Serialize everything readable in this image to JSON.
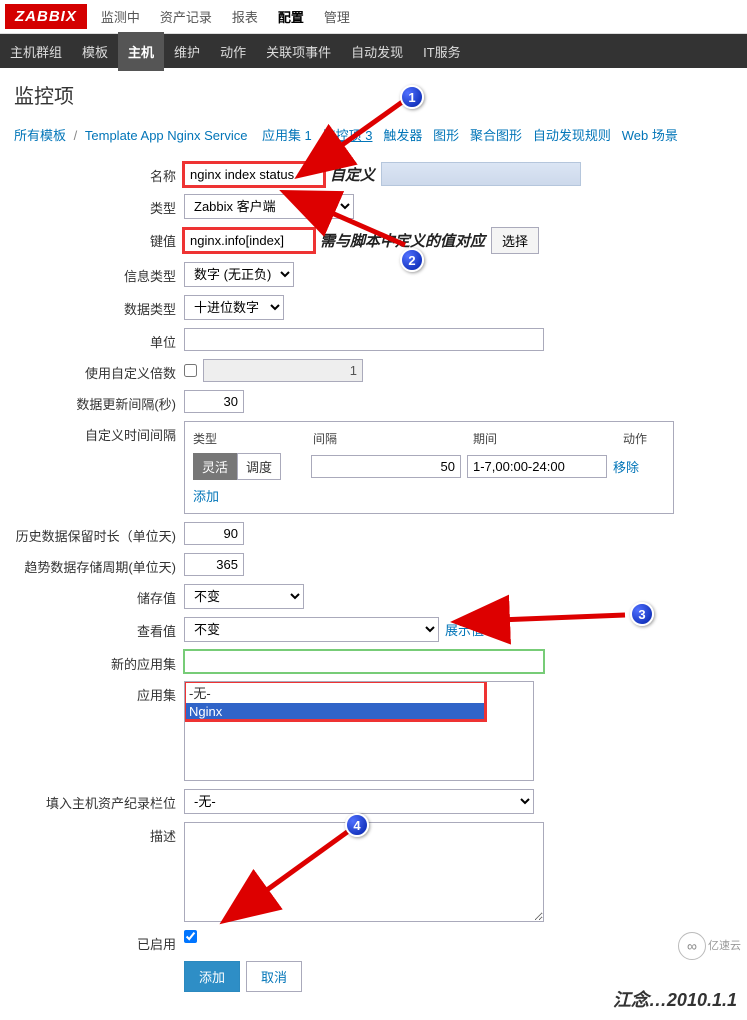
{
  "topmenu": [
    "监测中",
    "资产记录",
    "报表",
    "配置",
    "管理"
  ],
  "topmenu_active": 3,
  "submenu": [
    "主机群组",
    "模板",
    "主机",
    "维护",
    "动作",
    "关联项事件",
    "自动发现",
    "IT服务"
  ],
  "submenu_active": 2,
  "page_title": "监控项",
  "breadcrumb": {
    "all_templates": "所有模板",
    "template_name": "Template App Nginx Service",
    "items": [
      {
        "label": "应用集 1"
      },
      {
        "label": "监控项 3",
        "active": true
      },
      {
        "label": "触发器"
      },
      {
        "label": "图形"
      },
      {
        "label": "聚合图形"
      },
      {
        "label": "自动发现规则"
      },
      {
        "label": "Web 场景"
      }
    ]
  },
  "form": {
    "name_label": "名称",
    "name_value": "nginx index status",
    "name_annotation": "自定义",
    "type_label": "类型",
    "type_value": "Zabbix 客户端",
    "key_label": "键值",
    "key_value": "nginx.info[index]",
    "key_annotation": "需与脚本中定义的值对应",
    "key_select_btn": "选择",
    "info_type_label": "信息类型",
    "info_type_value": "数字 (无正负)",
    "data_type_label": "数据类型",
    "data_type_value": "十进位数字",
    "unit_label": "单位",
    "unit_value": "",
    "custom_mult_label": "使用自定义倍数",
    "custom_mult_value": "1",
    "update_interval_label": "数据更新间隔(秒)",
    "update_interval_value": "30",
    "custom_interval_label": "自定义时间间隔",
    "interval_header_type": "类型",
    "interval_header_interval": "间隔",
    "interval_header_period": "期间",
    "interval_header_action": "动作",
    "interval_tab_flex": "灵活",
    "interval_tab_sched": "调度",
    "interval_value": "50",
    "interval_period": "1-7,00:00-24:00",
    "interval_remove": "移除",
    "interval_add": "添加",
    "history_label": "历史数据保留时长（单位天)",
    "history_value": "90",
    "trend_label": "趋势数据存储周期(单位天)",
    "trend_value": "365",
    "store_label": "储存值",
    "store_value": "不变",
    "show_value_label": "查看值",
    "show_value_value": "不变",
    "show_value_link": "展示值映射",
    "new_app_label": "新的应用集",
    "new_app_value": "",
    "app_label": "应用集",
    "app_options": [
      "-无-",
      "Nginx"
    ],
    "app_selected": "Nginx",
    "inventory_label": "填入主机资产纪录栏位",
    "inventory_value": "-无-",
    "desc_label": "描述",
    "desc_value": "",
    "enabled_label": "已启用",
    "submit_add": "添加",
    "submit_cancel": "取消"
  },
  "annotations": {
    "badge1": "1",
    "badge2": "2",
    "badge3": "3",
    "badge4": "4"
  },
  "watermark": "江念…2010.1.1",
  "watermark2": "亿速云"
}
